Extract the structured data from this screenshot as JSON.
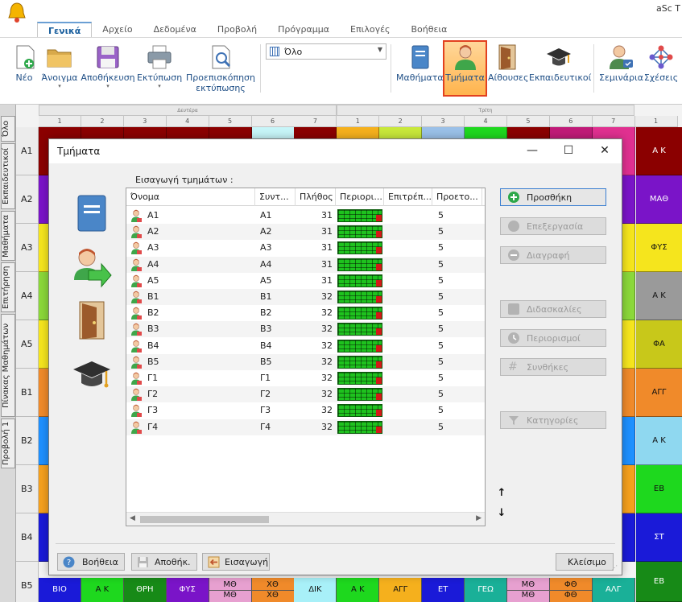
{
  "app": {
    "title": "aSc T"
  },
  "ribbon": {
    "tabs": [
      "Γενικά",
      "Αρχείο",
      "Δεδομένα",
      "Προβολή",
      "Πρόγραμμα",
      "Επιλογές",
      "Βοήθεια"
    ],
    "active_tab": "Γενικά",
    "buttons": {
      "new": "Νέο",
      "open": "Άνοιγμα",
      "save": "Αποθήκευση",
      "print": "Εκτύπωση",
      "preview_line1": "Προεπισκόπηση",
      "preview_line2": "εκτύπωσης",
      "subjects": "Μαθήματα",
      "classes": "Τμήματα",
      "rooms": "Αίθουσες",
      "teachers": "Εκπαιδευτικοί",
      "seminars": "Σεμινάρια",
      "relations": "Σχέσεις"
    },
    "view_select": "Όλο"
  },
  "timetable": {
    "side_tabs": [
      "Όλο",
      "Εκπαιδευτικοί",
      "Μαθήματα",
      "Επιτήρηση",
      "Πίνακας Μαθημάτων",
      "Προβολή 1"
    ],
    "day_headers": [
      "Δευτέρα",
      "Τρίτη"
    ],
    "periods": [
      "1",
      "2",
      "3",
      "4",
      "5",
      "6",
      "7",
      "1",
      "2",
      "3",
      "4",
      "5",
      "6",
      "7",
      "1"
    ],
    "row_labels": [
      "A1",
      "A2",
      "A3",
      "A4",
      "A5",
      "B1",
      "B2",
      "B3",
      "B4",
      "B5"
    ],
    "right_column": [
      "Α Κ",
      "ΜΑΘ",
      "ΦΥΣ",
      "Α Κ",
      "ΦΑ",
      "ΑΓΓ",
      "Α Κ",
      "ΕΒ",
      "ΣΤ"
    ],
    "right_column_b5": "ΕΒ",
    "b5_row": [
      {
        "text": "ΒΙΟ",
        "color": "#1a1ad8"
      },
      {
        "text": "Α Κ",
        "color": "#1ed81e"
      },
      {
        "text": "ΘΡΗ",
        "color": "#178a17"
      },
      {
        "text": "ΦΥΣ",
        "color": "#7a14c8"
      },
      {
        "text": "ΜΘ",
        "text2": "ΜΘ",
        "color": "#e7a0d0"
      },
      {
        "text": "ΧΘ",
        "text2": "ΧΘ",
        "color": "#f08a2a"
      },
      {
        "text": "ΔΙΚ",
        "color": "#a8f0f8"
      },
      {
        "text": "Α Κ",
        "color": "#1ed81e"
      },
      {
        "text": "ΑΓΓ",
        "color": "#f5b01d"
      },
      {
        "text": "ΕΤ",
        "color": "#1a1ad8"
      },
      {
        "text": "ΓΕΩ",
        "color": "#1ab098"
      },
      {
        "text": "ΜΘ",
        "text2": "ΜΘ",
        "color": "#e7a0d0"
      },
      {
        "text": "ΦΘ",
        "text2": "ΦΘ",
        "color": "#f08a2a"
      },
      {
        "text": "ΑΛΓ",
        "color": "#1ab098"
      }
    ]
  },
  "dialog": {
    "title": "Τμήματα",
    "list_label": "Εισαγωγή τμημάτων :",
    "columns": [
      "Όνομα",
      "Συντ...",
      "Πλήθος",
      "Περιορι...",
      "Επιτρέπ...",
      "Προετο..."
    ],
    "rows": [
      {
        "name": "A1",
        "short": "A1",
        "count": "31",
        "prep": "5"
      },
      {
        "name": "A2",
        "short": "A2",
        "count": "31",
        "prep": "5"
      },
      {
        "name": "A3",
        "short": "A3",
        "count": "31",
        "prep": "5"
      },
      {
        "name": "A4",
        "short": "A4",
        "count": "31",
        "prep": "5"
      },
      {
        "name": "A5",
        "short": "A5",
        "count": "31",
        "prep": "5"
      },
      {
        "name": "B1",
        "short": "B1",
        "count": "32",
        "prep": "5"
      },
      {
        "name": "B2",
        "short": "B2",
        "count": "32",
        "prep": "5"
      },
      {
        "name": "B3",
        "short": "B3",
        "count": "32",
        "prep": "5"
      },
      {
        "name": "B4",
        "short": "B4",
        "count": "32",
        "prep": "5"
      },
      {
        "name": "B5",
        "short": "B5",
        "count": "32",
        "prep": "5"
      },
      {
        "name": "Γ1",
        "short": "Γ1",
        "count": "32",
        "prep": "5"
      },
      {
        "name": "Γ2",
        "short": "Γ2",
        "count": "32",
        "prep": "5"
      },
      {
        "name": "Γ3",
        "short": "Γ3",
        "count": "32",
        "prep": "5"
      },
      {
        "name": "Γ4",
        "short": "Γ4",
        "count": "32",
        "prep": "5"
      }
    ],
    "actions": {
      "add": "Προσθήκη",
      "edit": "Επεξεργασία",
      "delete": "Διαγραφή",
      "teachers": "Διδασκαλίες",
      "constraints": "Περιορισμοί",
      "conditions": "Συνθήκες",
      "categories": "Κατηγορίες"
    },
    "footer": {
      "help": "Βοήθεια",
      "save": "Αποθήκ.",
      "import": "Εισαγωγή",
      "close": "Κλείσιμο"
    }
  },
  "colors": {
    "accent": "#1a5f9e",
    "highlight_border": "#e2401f",
    "add_icon": "#2da84a"
  }
}
